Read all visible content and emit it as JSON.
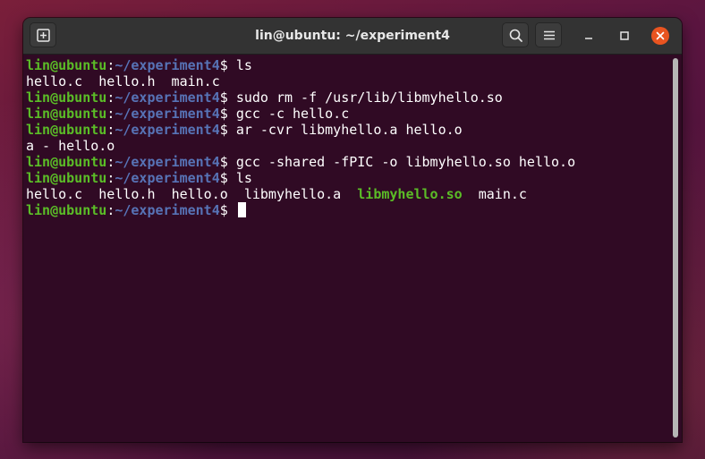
{
  "window": {
    "title": "lin@ubuntu: ~/experiment4"
  },
  "icons": {
    "new_tab": "new-tab-icon",
    "search": "search-icon",
    "menu": "hamburger-menu-icon",
    "minimize": "minimize-icon",
    "maximize": "maximize-icon",
    "close": "close-icon"
  },
  "colors": {
    "terminal_bg": "#300a24",
    "prompt_user": "#5bbd27",
    "prompt_path": "#5773b6",
    "executable": "#5bbd27",
    "close_button": "#e95420"
  },
  "prompt": {
    "user": "lin@ubuntu",
    "sep": ":",
    "path": "~/experiment4",
    "symbol": "$ "
  },
  "terminal": {
    "lines": [
      {
        "type": "cmd",
        "text": "ls"
      },
      {
        "type": "out",
        "text": "hello.c  hello.h  main.c"
      },
      {
        "type": "cmd",
        "text": "sudo rm -f /usr/lib/libmyhello.so"
      },
      {
        "type": "cmd",
        "text": "gcc -c hello.c"
      },
      {
        "type": "cmd",
        "text": "ar -cvr libmyhello.a hello.o"
      },
      {
        "type": "out",
        "text": "a - hello.o"
      },
      {
        "type": "cmd",
        "text": "gcc -shared -fPIC -o libmyhello.so hello.o"
      },
      {
        "type": "cmd",
        "text": "ls"
      },
      {
        "type": "ls",
        "files": [
          {
            "name": "hello.c",
            "exec": false
          },
          {
            "name": "hello.h",
            "exec": false
          },
          {
            "name": "hello.o",
            "exec": false
          },
          {
            "name": "libmyhello.a",
            "exec": false
          },
          {
            "name": "libmyhello.so",
            "exec": true
          },
          {
            "name": "main.c",
            "exec": false
          }
        ]
      },
      {
        "type": "cmd",
        "text": "",
        "cursor": true
      }
    ]
  }
}
